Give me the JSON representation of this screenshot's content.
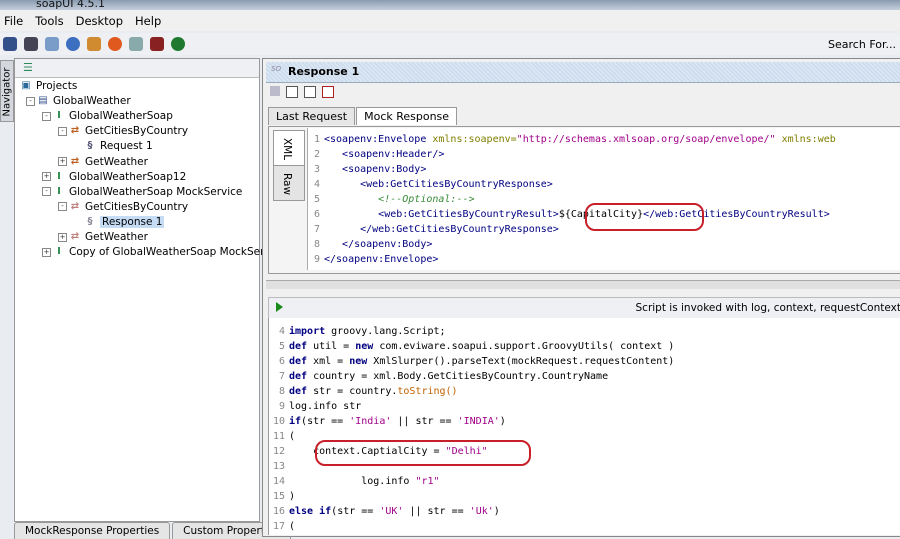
{
  "window": {
    "title": "soapUI 4.5.1"
  },
  "menu": [
    "File",
    "Tools",
    "Desktop",
    "Help"
  ],
  "toolbar": {
    "icons": [
      "new-project-icon",
      "import-icon",
      "save-icon",
      "help-icon",
      "users-icon",
      "soapui-icon",
      "preferences-icon",
      "exit-icon",
      "forum-icon"
    ],
    "search_label": "Search For..."
  },
  "navigator": {
    "label": "Navigator"
  },
  "tree": [
    {
      "label": "Projects",
      "icon": "projects-icon",
      "depth": 0
    },
    {
      "label": "GlobalWeather",
      "icon": "project-icon",
      "depth": 1,
      "exp": "-"
    },
    {
      "label": "GlobalWeatherSoap",
      "icon": "interface-icon",
      "depth": 2,
      "exp": "-"
    },
    {
      "label": "GetCitiesByCountry",
      "icon": "operation-icon",
      "depth": 3,
      "exp": "-"
    },
    {
      "label": "Request 1",
      "icon": "soap-request-icon",
      "depth": 4
    },
    {
      "label": "GetWeather",
      "icon": "operation-icon",
      "depth": 3,
      "exp": "+"
    },
    {
      "label": "GlobalWeatherSoap12",
      "icon": "interface-icon",
      "depth": 2,
      "exp": "+"
    },
    {
      "label": "GlobalWeatherSoap MockService",
      "icon": "mockservice-icon",
      "depth": 2,
      "exp": "-"
    },
    {
      "label": "GetCitiesByCountry",
      "icon": "mock-operation-icon",
      "depth": 3,
      "exp": "-"
    },
    {
      "label": "Response 1",
      "icon": "mock-response-icon",
      "depth": 4,
      "selected": true
    },
    {
      "label": "GetWeather",
      "icon": "mock-operation-icon",
      "depth": 3,
      "exp": "+"
    },
    {
      "label": "Copy of GlobalWeatherSoap MockService",
      "icon": "mockservice-icon",
      "depth": 2,
      "exp": "+"
    }
  ],
  "bottom_tabs": [
    "MockResponse Properties",
    "Custom Properties"
  ],
  "response": {
    "title": "Response 1",
    "tabs": [
      "Last Request",
      "Mock Response"
    ],
    "active_tab": "Mock Response",
    "side_tabs": [
      "XML",
      "Raw"
    ]
  },
  "xml_lines": [
    {
      "n": "1",
      "segs": [
        [
          "<soapenv:Envelope ",
          "tag"
        ],
        [
          "xmlns:soapenv=",
          "attr"
        ],
        [
          "\"http://schemas.xmlsoap.org/soap/envelope/\"",
          "val"
        ],
        [
          " xmlns:web",
          "attr"
        ]
      ]
    },
    {
      "n": "2",
      "segs": [
        [
          "   <soapenv:Header/>",
          "tag"
        ]
      ]
    },
    {
      "n": "3",
      "segs": [
        [
          "   <soapenv:Body>",
          "tag"
        ]
      ]
    },
    {
      "n": "4",
      "segs": [
        [
          "      <web:GetCitiesByCountryResponse>",
          "tag"
        ]
      ]
    },
    {
      "n": "5",
      "segs": [
        [
          "         <!--Optional:-->",
          "com"
        ]
      ]
    },
    {
      "n": "6",
      "segs": [
        [
          "         <web:GetCitiesByCountryResult>",
          "tag"
        ],
        [
          "${CapitalCity}",
          "txt"
        ],
        [
          "</web:GetCitiesByCountryResult>",
          "tag"
        ]
      ]
    },
    {
      "n": "7",
      "segs": [
        [
          "      </web:GetCitiesByCountryResponse>",
          "tag"
        ]
      ]
    },
    {
      "n": "8",
      "segs": [
        [
          "   </soapenv:Body>",
          "tag"
        ]
      ]
    },
    {
      "n": "9",
      "segs": [
        [
          "</soapenv:Envelope>",
          "tag"
        ]
      ]
    }
  ],
  "script": {
    "hint": "Script is invoked with log, context, requestContext",
    "lines": [
      {
        "n": "4",
        "segs": [
          [
            "import",
            "kw"
          ],
          [
            " groovy.lang.Script;",
            "txt"
          ]
        ]
      },
      {
        "n": "5",
        "segs": [
          [
            "def",
            "kw"
          ],
          [
            " util = ",
            "txt"
          ],
          [
            "new",
            "kw"
          ],
          [
            " com.eviware.soapui.support.GroovyUtils( context )",
            "txt"
          ]
        ]
      },
      {
        "n": "6",
        "segs": [
          [
            "def",
            "kw"
          ],
          [
            " xml = ",
            "txt"
          ],
          [
            "new",
            "kw"
          ],
          [
            " XmlSlurper().parseText(mockRequest.requestContent)",
            "txt"
          ]
        ]
      },
      {
        "n": "7",
        "segs": [
          [
            "def",
            "kw"
          ],
          [
            " country = xml.Body.GetCitiesByCountry.CountryName",
            "txt"
          ]
        ]
      },
      {
        "n": "8",
        "segs": [
          [
            "def",
            "kw"
          ],
          [
            " str = country.",
            "txt"
          ],
          [
            "toString()",
            "meth"
          ]
        ]
      },
      {
        "n": "9",
        "segs": [
          [
            "log.info str",
            "txt"
          ]
        ]
      },
      {
        "n": "10",
        "segs": [
          [
            "if",
            "kw"
          ],
          [
            "(str == ",
            "txt"
          ],
          [
            "'India'",
            "str"
          ],
          [
            " || str == ",
            "txt"
          ],
          [
            "'INDIA'",
            "str"
          ],
          [
            ")",
            "txt"
          ]
        ]
      },
      {
        "n": "11",
        "segs": [
          [
            "(",
            "txt"
          ]
        ]
      },
      {
        "n": "12",
        "segs": [
          [
            "    context.CaptialCity = ",
            "txt"
          ],
          [
            "\"Delhi\"",
            "str"
          ]
        ]
      },
      {
        "n": "13",
        "segs": [
          [
            "",
            "txt"
          ]
        ]
      },
      {
        "n": "14",
        "segs": [
          [
            "            log.info ",
            "txt"
          ],
          [
            "\"r1\"",
            "str"
          ]
        ]
      },
      {
        "n": "15",
        "segs": [
          [
            ")",
            "txt"
          ]
        ]
      },
      {
        "n": "16",
        "segs": [
          [
            "else",
            "kw"
          ],
          [
            " ",
            "txt"
          ],
          [
            "if",
            "kw"
          ],
          [
            "(str == ",
            "txt"
          ],
          [
            "'UK'",
            "str"
          ],
          [
            " || str == ",
            "txt"
          ],
          [
            "'Uk'",
            "str"
          ],
          [
            ")",
            "txt"
          ]
        ]
      },
      {
        "n": "17",
        "segs": [
          [
            "(",
            "txt"
          ]
        ]
      }
    ]
  },
  "annotation_color": "#c8202a"
}
